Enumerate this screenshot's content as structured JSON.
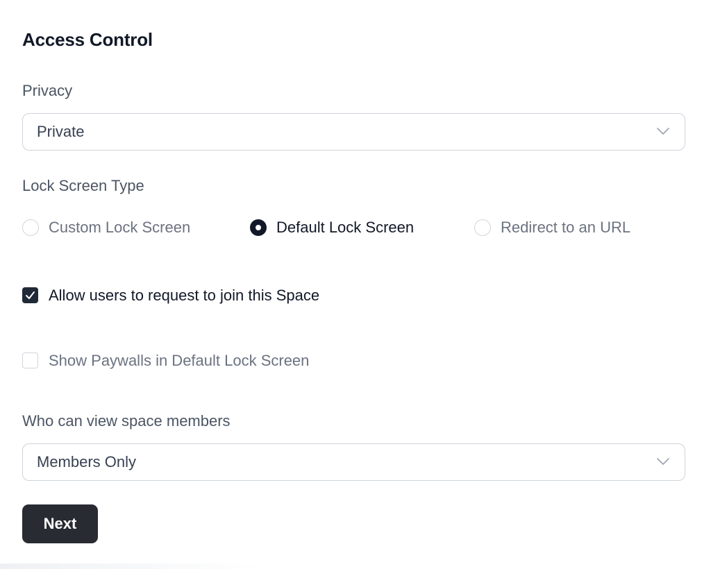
{
  "form": {
    "section_title": "Access Control",
    "privacy": {
      "label": "Privacy",
      "value": "Private"
    },
    "lock_screen": {
      "label": "Lock Screen Type",
      "options": [
        {
          "label": "Custom Lock Screen",
          "checked": false
        },
        {
          "label": "Default Lock Screen",
          "checked": true
        },
        {
          "label": "Redirect to an URL",
          "checked": false
        }
      ]
    },
    "allow_join": {
      "label": "Allow users to request to join this Space",
      "checked": true
    },
    "show_paywalls": {
      "label": "Show Paywalls in Default Lock Screen",
      "checked": false
    },
    "members_visibility": {
      "label": "Who can view space members",
      "value": "Members Only"
    },
    "next_label": "Next"
  },
  "icons": {
    "select_chevron": "chevron-down-icon",
    "check_mark": "checkmark-icon"
  },
  "colors": {
    "primary_dark": "#282b31",
    "text_primary": "#111827",
    "text_muted": "#6b7280",
    "border": "#cfd3d9"
  }
}
